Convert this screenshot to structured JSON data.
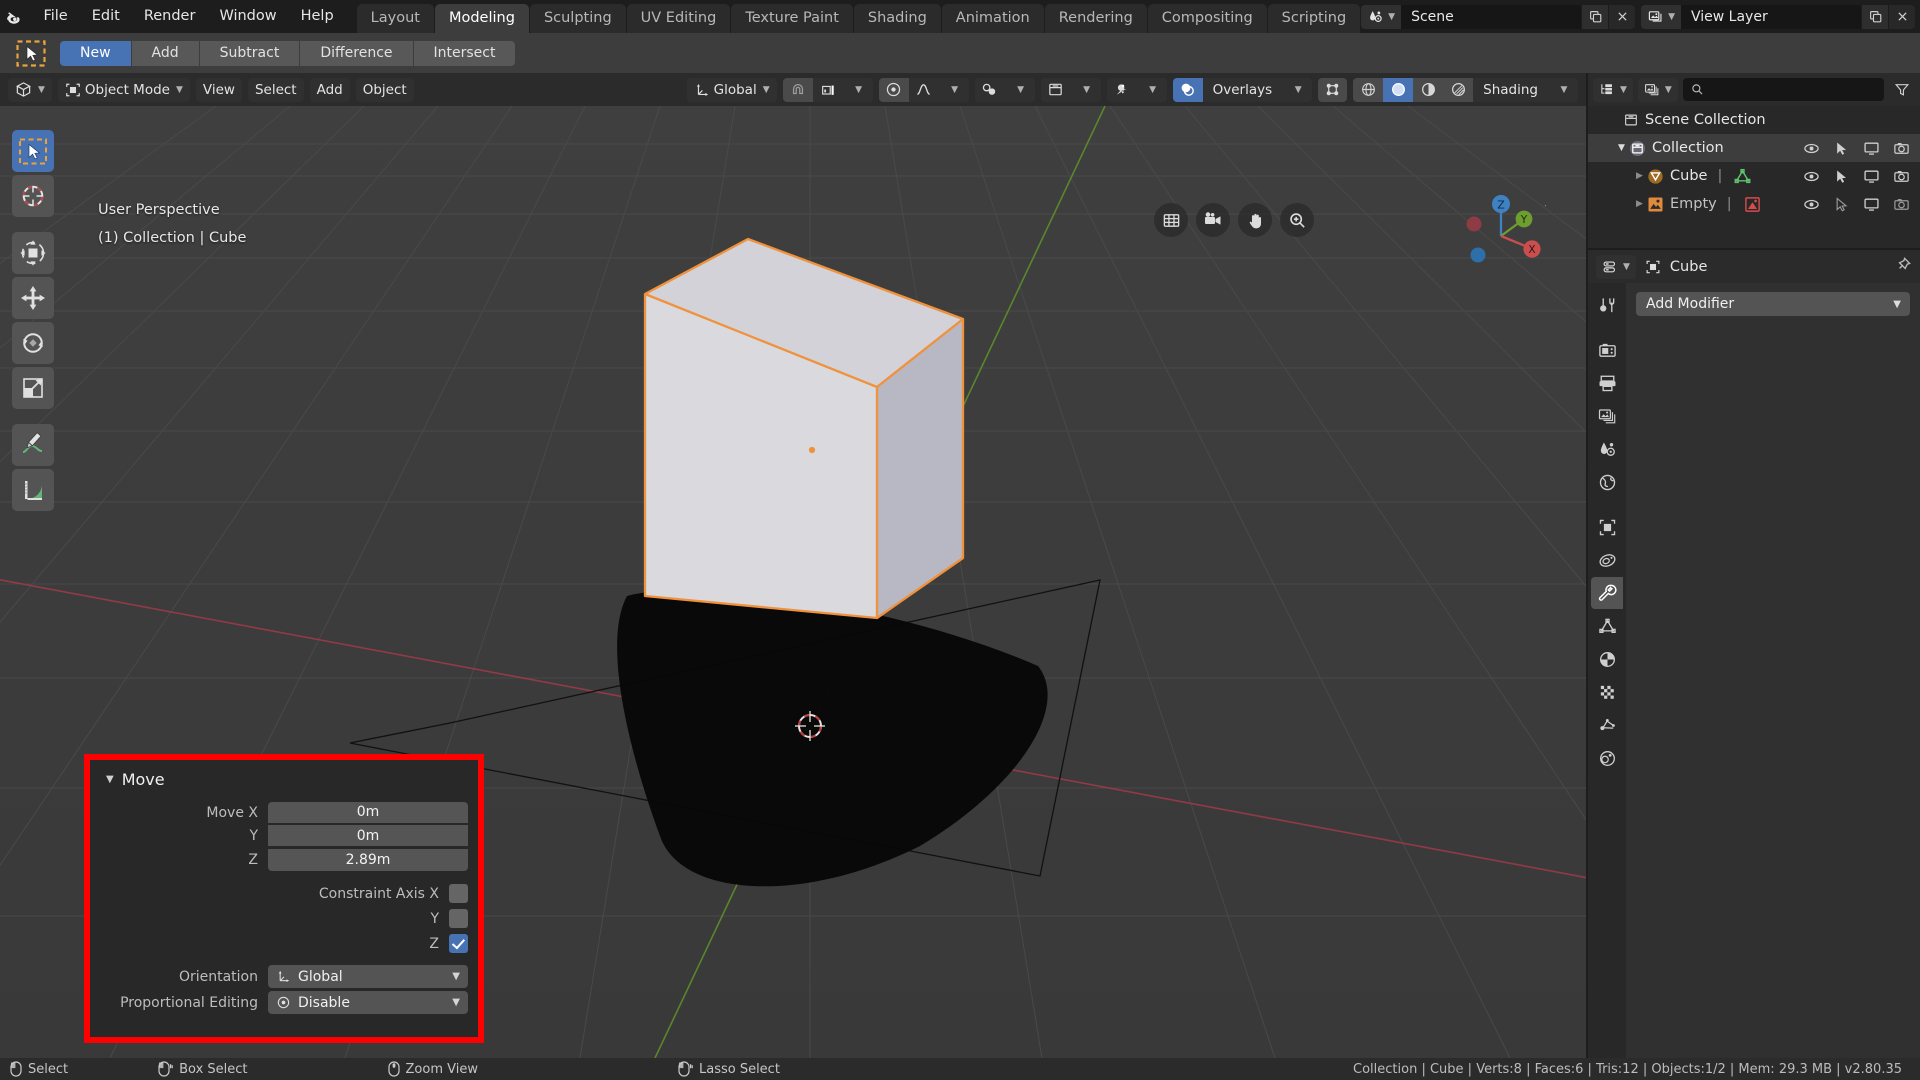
{
  "app": {
    "logo_icon": "blender-logo-icon",
    "menus": [
      "File",
      "Edit",
      "Render",
      "Window",
      "Help"
    ],
    "workspace_tabs": [
      {
        "label": "Layout",
        "active": false
      },
      {
        "label": "Modeling",
        "active": true
      },
      {
        "label": "Sculpting",
        "active": false
      },
      {
        "label": "UV Editing",
        "active": false
      },
      {
        "label": "Texture Paint",
        "active": false
      },
      {
        "label": "Shading",
        "active": false
      },
      {
        "label": "Animation",
        "active": false
      },
      {
        "label": "Rendering",
        "active": false
      },
      {
        "label": "Compositing",
        "active": false
      },
      {
        "label": "Scripting",
        "active": false
      }
    ],
    "scene": {
      "icon": "scene-icon",
      "name": "Scene",
      "new_icon": "new-scene-icon",
      "remove_icon": "close-icon"
    },
    "view_layer": {
      "icon": "view-layer-icon",
      "name": "View Layer",
      "new_icon": "copy-icon",
      "remove_icon": "close-icon"
    }
  },
  "tool_settings": {
    "active_tool_icon": "tweak-select-box-icon",
    "boolean_modes": [
      {
        "label": "New",
        "active": true
      },
      {
        "label": "Add",
        "active": false
      },
      {
        "label": "Subtract",
        "active": false
      },
      {
        "label": "Difference",
        "active": false
      },
      {
        "label": "Intersect",
        "active": false
      }
    ]
  },
  "toolbar": {
    "tools": [
      {
        "name": "select-box-tool",
        "active": true
      },
      {
        "name": "cursor-tool",
        "active": false
      },
      {
        "name": "move-rotate-scale-tool",
        "active": false
      },
      {
        "name": "move-tool",
        "active": false
      },
      {
        "name": "rotate-tool",
        "active": false
      },
      {
        "name": "scale-tool",
        "active": false
      },
      {
        "name": "annotate-tool",
        "active": false
      },
      {
        "name": "measure-tool",
        "active": false
      }
    ]
  },
  "viewport": {
    "header": {
      "editor_type_icon": "editor-type-3dview-icon",
      "mode": "Object Mode",
      "menus": [
        "View",
        "Select",
        "Add",
        "Object"
      ],
      "transform_orientation": "Global",
      "snap_icon": "magnet-icon",
      "snap_target_icon": "snap-increment-icon",
      "proportional_icon": "proportional-editing-icon",
      "falloff_icon": "falloff-smooth-icon",
      "mirror_icon": "mirror-icon",
      "visibility_icon": "scene-collection-visibility-icon",
      "gizmo_icon": "gizmo-icon",
      "overlays_label": "Overlays",
      "overlays_icon": "overlays-icon",
      "xray_icon": "xray-icon",
      "shading_label": "Shading",
      "shading_modes": [
        {
          "name": "wireframe-shading",
          "active": false
        },
        {
          "name": "solid-shading",
          "active": true
        },
        {
          "name": "material-preview-shading",
          "active": false
        },
        {
          "name": "rendered-shading",
          "active": false
        }
      ]
    },
    "overlay_text": {
      "view_name": "User Perspective",
      "context": "(1) Collection | Cube"
    },
    "nav_buttons": [
      {
        "name": "toggle-orthographic-icon"
      },
      {
        "name": "camera-view-icon"
      },
      {
        "name": "pan-view-icon"
      },
      {
        "name": "zoom-view-icon"
      }
    ],
    "gizmo_axes": [
      "Z",
      "Y",
      "X"
    ]
  },
  "move_panel": {
    "title": "Move",
    "collapse_icon": "triangle-down-icon",
    "fields": [
      {
        "label": "Move X",
        "value": "0m"
      },
      {
        "label": "Y",
        "value": "0m"
      },
      {
        "label": "Z",
        "value": "2.89m"
      }
    ],
    "constraints": [
      {
        "label": "Constraint Axis X",
        "checked": false
      },
      {
        "label": "Y",
        "checked": false
      },
      {
        "label": "Z",
        "checked": true
      }
    ],
    "orientation": {
      "label": "Orientation",
      "value": "Global",
      "icon": "orientation-icon"
    },
    "proportional": {
      "label": "Proportional Editing",
      "value": "Disable",
      "icon": "radio-dot-icon"
    },
    "highlight_color": "#ff0000"
  },
  "outliner": {
    "display_mode_icon": "outliner-display-mode-icon",
    "filter_id_icon": "filter-id-icon",
    "search_icon": "search-icon",
    "search_value": "",
    "filter_icon": "funnel-filter-icon",
    "rows": [
      {
        "name": "Scene Collection",
        "icon": "scene-collection-icon",
        "indent": 0,
        "selected": false,
        "disclosure": "",
        "type_icon": "",
        "show_icons": false
      },
      {
        "name": "Collection",
        "icon": "collection-icon",
        "indent": 1,
        "selected": true,
        "disclosure": "▼",
        "type_icon": "",
        "show_icons": true
      },
      {
        "name": "Cube",
        "icon": "mesh-object-icon",
        "indent": 2,
        "selected": false,
        "disclosure": "▶",
        "type_icon": "mesh-data-icon",
        "show_icons": true
      },
      {
        "name": "Empty",
        "icon": "empty-image-object-icon",
        "indent": 2,
        "selected": false,
        "disclosure": "▶",
        "type_icon": "empty-image-data-icon",
        "show_icons": true
      }
    ],
    "row_icons": [
      "eye-icon",
      "cursor-select-icon",
      "monitor-icon",
      "camera-icon"
    ]
  },
  "properties": {
    "editor_icon": "properties-editor-icon",
    "breadcrumb_icon": "object-icon",
    "breadcrumb": "Cube",
    "pin_icon": "pin-icon",
    "tabs": [
      {
        "name": "tool-tab",
        "active": false
      },
      {
        "name": "render-tab",
        "active": false
      },
      {
        "name": "output-tab",
        "active": false
      },
      {
        "name": "view-layer-tab",
        "active": false
      },
      {
        "name": "scene-tab",
        "active": false
      },
      {
        "name": "world-tab",
        "active": false
      },
      {
        "name": "object-tab",
        "active": false
      },
      {
        "name": "modifiers-physics-tab",
        "active": false
      },
      {
        "name": "modifier-properties-tab",
        "active": true
      },
      {
        "name": "particles-tab",
        "active": false
      },
      {
        "name": "physics-tab",
        "active": false
      },
      {
        "name": "object-constraints-tab",
        "active": false
      },
      {
        "name": "object-data-tab",
        "active": false
      },
      {
        "name": "material-tab",
        "active": false
      }
    ],
    "add_modifier_label": "Add Modifier"
  },
  "status_bar": {
    "keymap": [
      {
        "icon": "mouse-left-icon",
        "label": "Select"
      },
      {
        "icon": "mouse-left-drag-icon",
        "label": "Box Select"
      },
      {
        "icon": "mouse-middle-icon",
        "label": "Zoom View"
      },
      {
        "icon": "mouse-left-drag-icon",
        "label": "Lasso Select"
      }
    ],
    "stats": "Collection | Cube | Verts:8 | Faces:6 | Tris:12 | Objects:1/2 | Mem: 29.3 MB | v2.80.35"
  }
}
